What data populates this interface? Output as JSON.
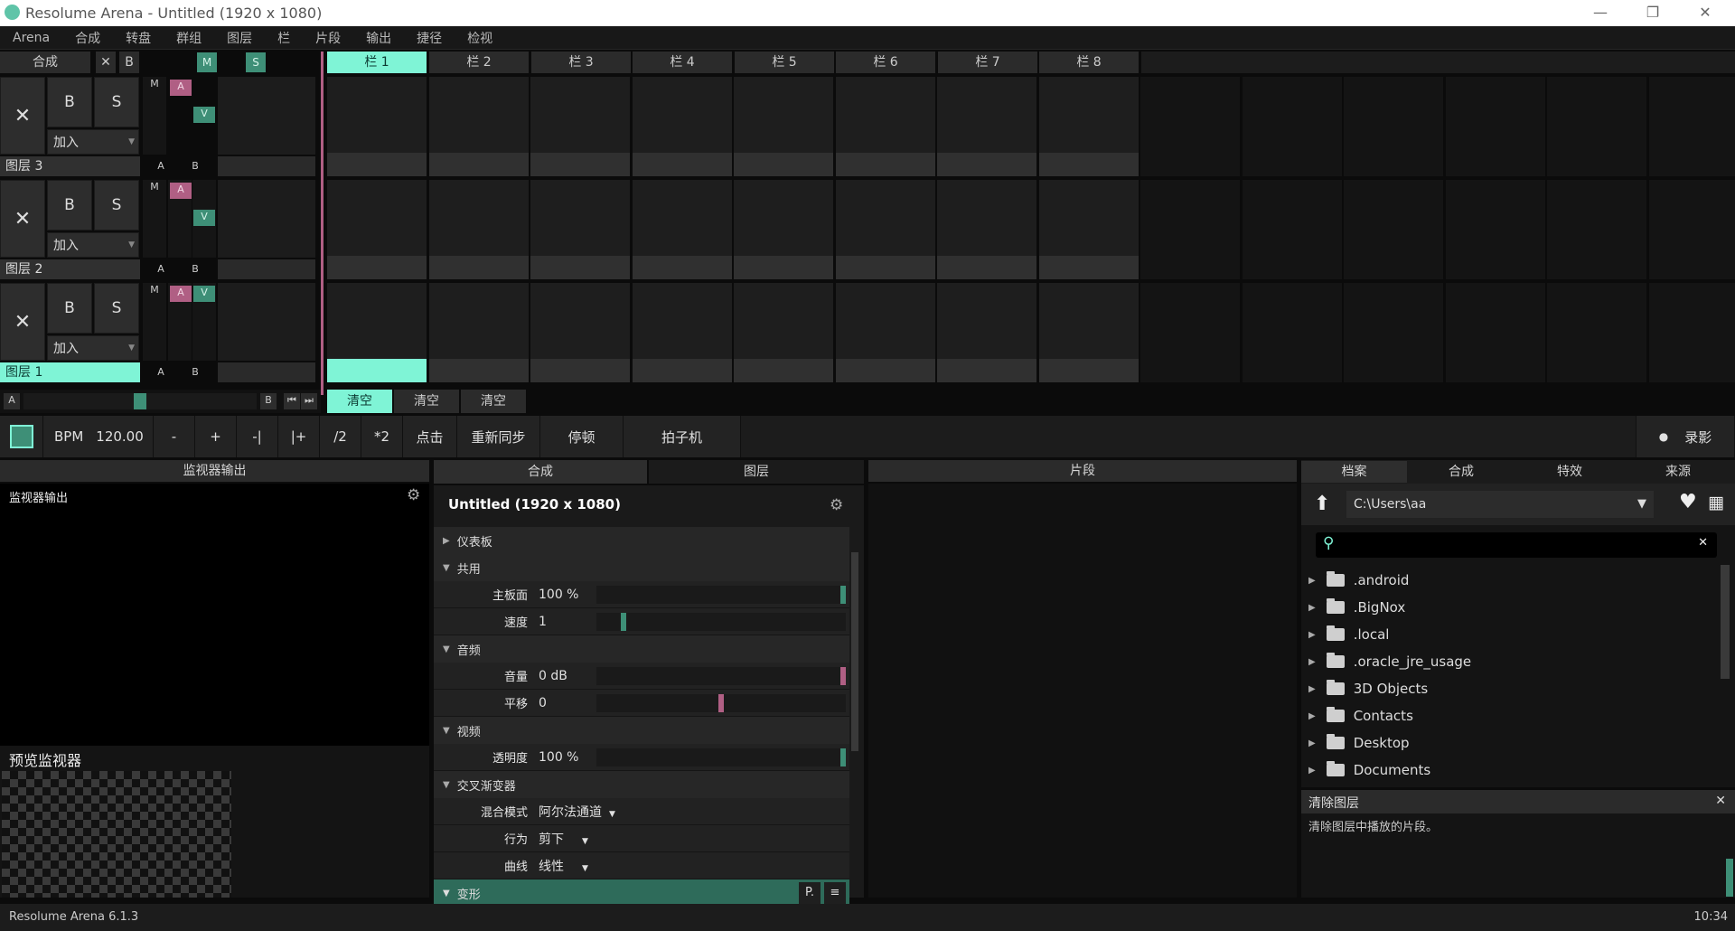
{
  "window": {
    "title": "Resolume Arena - Untitled (1920 x 1080)",
    "minimize": "—",
    "maximize": "❐",
    "close": "✕"
  },
  "menu": [
    "Arena",
    "合成",
    "转盘",
    "群组",
    "图层",
    "栏",
    "片段",
    "输出",
    "捷径",
    "检视"
  ],
  "composition": {
    "label": "合成",
    "x": "✕",
    "b": "B",
    "m": "M",
    "s": "S"
  },
  "columns": [
    "栏 1",
    "栏 2",
    "栏 3",
    "栏 4",
    "栏 5",
    "栏 6",
    "栏 7",
    "栏 8"
  ],
  "active_column_index": 0,
  "layers": [
    {
      "name": "图层 3",
      "b": "B",
      "s": "S",
      "blend": "加入",
      "m": "M",
      "a": "A",
      "v": "V",
      "ab_a": "A",
      "ab_b": "B",
      "active": false
    },
    {
      "name": "图层 2",
      "b": "B",
      "s": "S",
      "blend": "加入",
      "m": "M",
      "a": "A",
      "v": "V",
      "ab_a": "A",
      "ab_b": "B",
      "active": false
    },
    {
      "name": "图层 1",
      "b": "B",
      "s": "S",
      "blend": "加入",
      "m": "M",
      "a": "A",
      "v": "V",
      "ab_a": "A",
      "ab_b": "B",
      "active": true
    }
  ],
  "crossfader": {
    "a": "A",
    "b": "B",
    "clear_buttons": [
      "清空",
      "清空",
      "清空"
    ]
  },
  "transport": {
    "bpm_label": "BPM",
    "bpm_value": "120.00",
    "minus": "-",
    "plus": "+",
    "nudge_back": "-|",
    "nudge_fwd": "|+",
    "half": "/2",
    "double": "*2",
    "tap": "点击",
    "resync": "重新同步",
    "pause": "停顿",
    "metronome": "拍子机",
    "record": "录影"
  },
  "monitor": {
    "header": "监视器输出",
    "sub": "监视器输出",
    "preview": "预览监视器"
  },
  "center_tabs": [
    "合成",
    "图层"
  ],
  "clip_header": "片段",
  "comp_panel": {
    "title": "Untitled (1920 x 1080)",
    "dashboard": "仪表板",
    "common": "共用",
    "master_label": "主板面",
    "master_value": "100 %",
    "master_level": 1.0,
    "speed_label": "速度",
    "speed_value": "1",
    "speed_level": 0.1,
    "audio": "音频",
    "volume_label": "音量",
    "volume_value": "0 dB",
    "volume_level": 1.0,
    "pan_label": "平移",
    "pan_value": "0",
    "pan_level": 0.5,
    "video": "视频",
    "opacity_label": "透明度",
    "opacity_value": "100 %",
    "opacity_level": 1.0,
    "crossfader": "交叉渐变器",
    "blend_label": "混合模式",
    "blend_value": "阿尔法通道",
    "behavior_label": "行为",
    "behavior_value": "剪下",
    "curve_label": "曲线",
    "curve_value": "线性",
    "transform": "变形",
    "transform_p": "P."
  },
  "browser": {
    "tabs": [
      "档案",
      "合成",
      "特效",
      "来源"
    ],
    "path": "C:\\Users\\aa",
    "search": "",
    "files": [
      ".android",
      ".BigNox",
      ".local",
      ".oracle_jre_usage",
      "3D Objects",
      "Contacts",
      "Desktop",
      "Documents"
    ]
  },
  "help": {
    "title": "清除图层",
    "text": "清除图层中播放的片段。",
    "close": "✕"
  },
  "status": {
    "version": "Resolume Arena 6.1.3",
    "time": "10:34"
  },
  "colors": {
    "accent": "#7ff4d6",
    "pink": "#b05f84",
    "green": "#3e8f77"
  }
}
